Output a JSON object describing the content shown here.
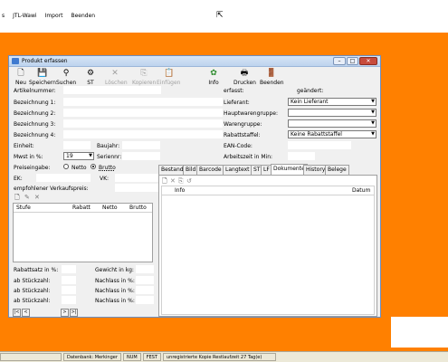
{
  "app_menu": [
    "s",
    "JTL-Wawi",
    "Import",
    "Beenden"
  ],
  "window": {
    "title": "Produkt erfassen"
  },
  "toolbar": {
    "neu": "Neu",
    "speichern": "Speichern",
    "suchen": "Suchen",
    "st_suchen": "ST Suchen",
    "loeschen": "Löschen",
    "kopieren": "Kopieren",
    "einfuegen": "Einfügen",
    "info": "Info",
    "drucken": "Drucken",
    "beenden": "Beenden"
  },
  "form": {
    "artikelnummer": "Artikelnummer:",
    "bezeichnung1": "Bezeichnung 1:",
    "bezeichnung2": "Bezeichnung 2:",
    "bezeichnung3": "Bezeichnung 3:",
    "bezeichnung4": "Bezeichnung 4:",
    "einheit": "Einheit:",
    "baujahr": "Baujahr:",
    "mwst": "Mwst in %:",
    "mwst_value": "19",
    "seriennr": "Seriennr:",
    "preiseingabe": "Preiseingabe:",
    "netto": "Netto",
    "brutto": "Brutto",
    "ek": "EK:",
    "vk": "VK:",
    "empf_vk": "empfohlener Verkaufspreis:"
  },
  "right": {
    "erfasst": "erfasst:",
    "geaendert": "geändert:",
    "lieferant": "Lieferant:",
    "lieferant_value": "Kein Lieferant",
    "hauptwarengruppe": "Hauptwarengruppe:",
    "warengruppe": "Warengruppe:",
    "rabattstaffel": "Rabattstaffel:",
    "rabattstaffel_value": "Keine Rabattstaffel",
    "ean": "EAN-Code:",
    "arbeitszeit": "Arbeitszeit in Min:"
  },
  "tabs": [
    "Bestand",
    "Bild",
    "Barcode",
    "Langtext",
    "ST",
    "LF",
    "Dokumente",
    "History",
    "Belege"
  ],
  "active_tab": "Dokumente",
  "doc_columns": {
    "info": "Info",
    "datum": "Datum"
  },
  "staffel_columns": {
    "stufe": "Stufe",
    "rabatt": "Rabatt",
    "netto": "Netto",
    "brutto": "Brutto"
  },
  "bottom": {
    "rabattsatz": "Rabattsatz in %:",
    "ab1": "ab Stückzahl:",
    "ab2": "ab Stückzahl:",
    "ab3": "ab Stückzahl:",
    "gewicht": "Gewicht in kg:",
    "nachlass1": "Nachlass in %:",
    "nachlass2": "Nachlass in %:",
    "nachlass3": "Nachlass in %:"
  },
  "statusbar": {
    "db": "Datenbank: Merkinger",
    "num": "NUM",
    "fest": "FEST",
    "license": "unregistrierte Kopie Restlaufzeit 27 Tag(e)"
  },
  "colors": {
    "desktop": "#ff8000",
    "title_close": "#c74b3c"
  }
}
